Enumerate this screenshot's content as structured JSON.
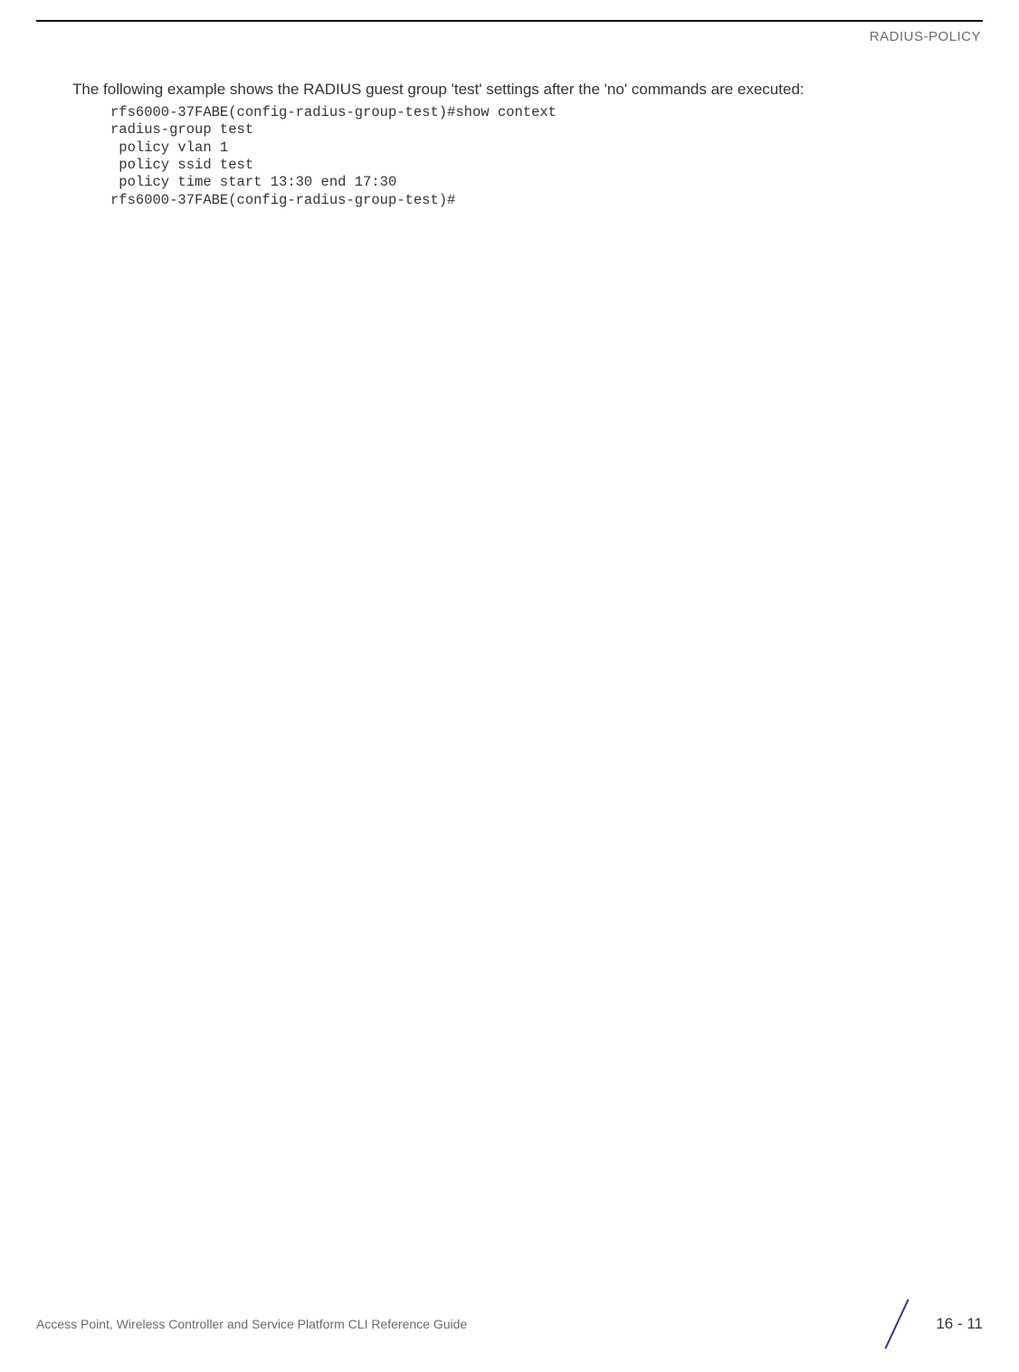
{
  "header": {
    "section_title": "RADIUS-POLICY"
  },
  "body": {
    "intro_paragraph": "The following example shows the RADIUS guest group 'test' settings after the 'no' commands are executed:",
    "code_lines": [
      "rfs6000-37FABE(config-radius-group-test)#show context",
      "radius-group test",
      " policy vlan 1",
      " policy ssid test",
      " policy time start 13:30 end 17:30",
      "rfs6000-37FABE(config-radius-group-test)#"
    ]
  },
  "footer": {
    "guide_title": "Access Point, Wireless Controller and Service Platform CLI Reference Guide",
    "page_number": "16 - 11"
  }
}
